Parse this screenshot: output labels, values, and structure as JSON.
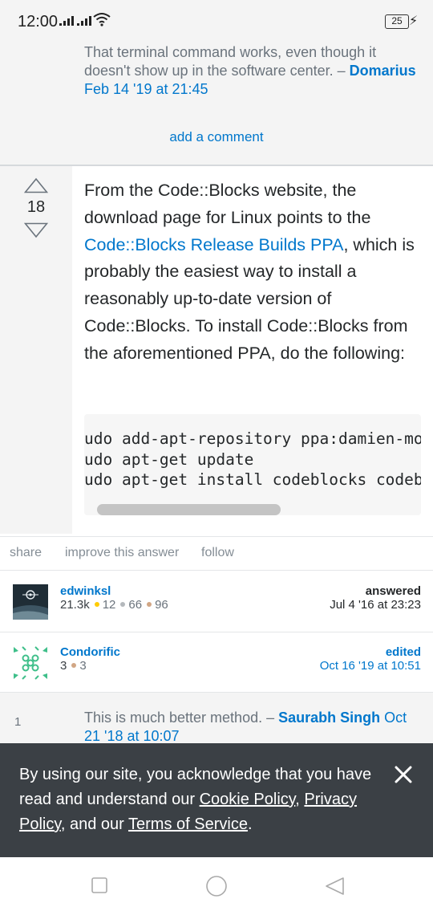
{
  "status_bar": {
    "time": "12:00",
    "battery": "25"
  },
  "top_comment": {
    "text": "That terminal command works, even though it doesn't show up in the software center. – ",
    "author": "Domarius",
    "date": "Feb 14 '19 at 21:45"
  },
  "add_comment_label": "add a comment",
  "answer": {
    "vote_count": "18",
    "text_before_link": "From the Code::Blocks website, the download page for Linux points to the ",
    "link_text": "Code::Blocks Release Builds PPA",
    "text_after_link": ", which is probably the easiest way to install a reasonably up-to-date version of Code::Blocks. To install Code::Blocks from the aforementioned PPA, do the following:",
    "code": [
      "udo add-apt-repository ppa:damien-mo",
      "udo apt-get update",
      "udo apt-get install codeblocks codeb"
    ],
    "scroll_fraction": 0.59
  },
  "actions": {
    "share": "share",
    "improve": "improve this answer",
    "follow": "follow"
  },
  "answerer": {
    "name": "edwinksl",
    "rep": "21.3k",
    "gold": "12",
    "silver": "66",
    "bronze": "96",
    "label": "answered",
    "date": "Jul 4 '16 at 23:23"
  },
  "editor": {
    "name": "Condorific",
    "rep": "3",
    "bronze": "3",
    "label": "edited",
    "date": "Oct 16 '19 at 10:51"
  },
  "second_comment": {
    "score": "1",
    "text": "This is much better method. – ",
    "author": "Saurabh Singh",
    "date": "Oct 21 '18 at 10:07"
  },
  "cookie_banner": {
    "text_1": "By using our site, you acknowledge that you have read and understand our ",
    "cookie_policy": "Cookie Policy",
    "comma": ", ",
    "privacy_policy": "Privacy Policy",
    "text_2": ", and our ",
    "terms": "Terms of Service",
    "period": "."
  },
  "colors": {
    "link": "#0077cc",
    "muted": "#6a737c",
    "banner": "#3b4045",
    "panel": "#f4f4f4"
  }
}
